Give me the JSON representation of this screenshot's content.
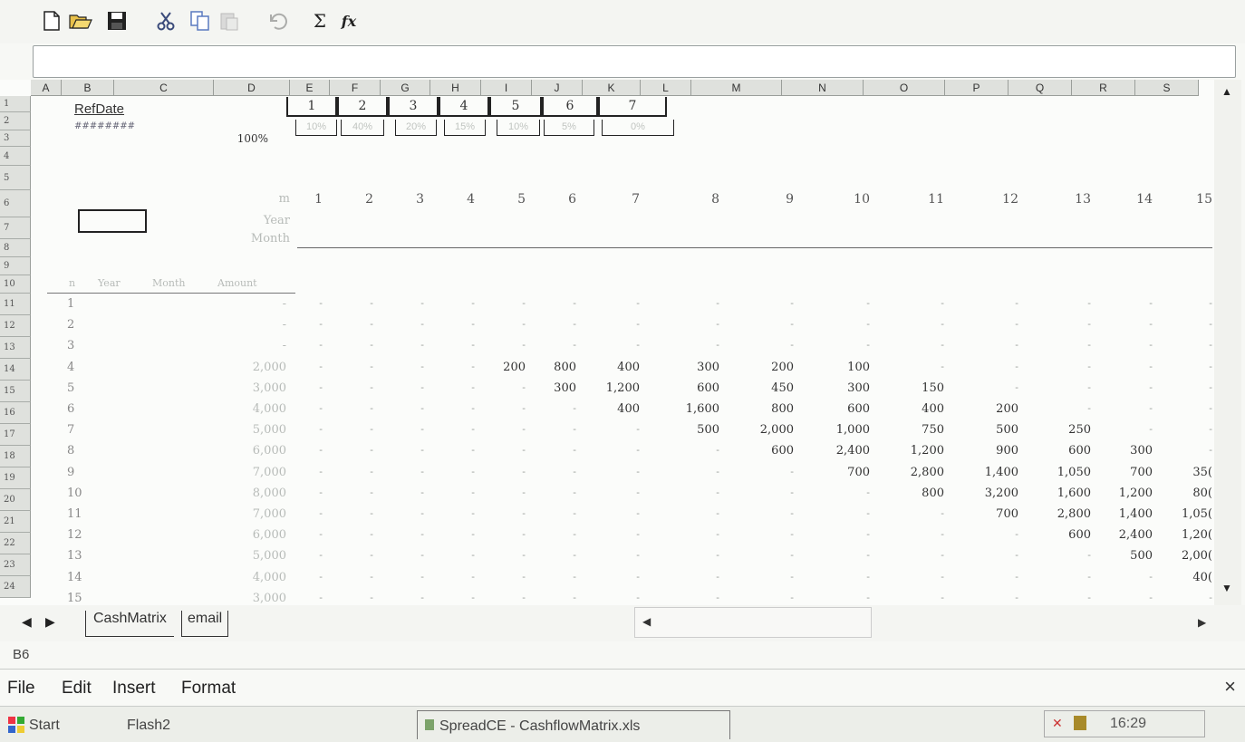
{
  "toolbar": {
    "icons": [
      "new-icon",
      "open-icon",
      "save-icon",
      "cut-icon",
      "copy-icon",
      "paste-icon",
      "undo-icon",
      "autosum-icon",
      "function-icon"
    ],
    "sum_glyph": "Σ",
    "fx_glyph": "fx"
  },
  "formula_bar": {
    "value": ""
  },
  "columns": [
    "A",
    "B",
    "C",
    "D",
    "E",
    "F",
    "G",
    "H",
    "I",
    "J",
    "K",
    "L",
    "M",
    "N",
    "O",
    "P",
    "Q",
    "R",
    "S"
  ],
  "rows": [
    "1",
    "2",
    "3",
    "4",
    "5",
    "6",
    "7",
    "8",
    "9",
    "10",
    "11",
    "12",
    "13",
    "14",
    "15",
    "16",
    "17",
    "18",
    "19",
    "20",
    "21",
    "22",
    "23",
    "24"
  ],
  "sheet": {
    "refdate_label": "RefDate",
    "refdate_value": "########",
    "pct_total": "100%",
    "period_boxes": [
      "1",
      "2",
      "3",
      "4",
      "5",
      "6",
      "7"
    ],
    "pct_boxes": [
      "10%",
      "40%",
      "20%",
      "15%",
      "10%",
      "5%",
      "0%"
    ],
    "row5_label": "m",
    "row6_label": "Year",
    "row7_label": "Month",
    "timeline": [
      "1",
      "2",
      "3",
      "4",
      "5",
      "6",
      "7",
      "8",
      "9",
      "10",
      "11",
      "12",
      "13",
      "14",
      "15"
    ],
    "table_headers": [
      "n",
      "Year",
      "Month",
      "Amount"
    ],
    "data_rows": [
      {
        "n": "1",
        "amount": "-",
        "cells": [
          "-",
          "-",
          "-",
          "-",
          "-",
          "-",
          "-",
          "-",
          "-",
          "-",
          "-",
          "-",
          "-",
          "-",
          "-"
        ]
      },
      {
        "n": "2",
        "amount": "-",
        "cells": [
          "-",
          "-",
          "-",
          "-",
          "-",
          "-",
          "-",
          "-",
          "-",
          "-",
          "-",
          "-",
          "-",
          "-",
          "-"
        ]
      },
      {
        "n": "3",
        "amount": "-",
        "cells": [
          "-",
          "-",
          "-",
          "-",
          "-",
          "-",
          "-",
          "-",
          "-",
          "-",
          "-",
          "-",
          "-",
          "-",
          "-"
        ]
      },
      {
        "n": "4",
        "amount": "2,000",
        "cells": [
          "-",
          "-",
          "-",
          "-",
          "200",
          "800",
          "400",
          "300",
          "200",
          "100",
          "-",
          "-",
          "-",
          "-",
          "-"
        ]
      },
      {
        "n": "5",
        "amount": "3,000",
        "cells": [
          "-",
          "-",
          "-",
          "-",
          "-",
          "300",
          "1,200",
          "600",
          "450",
          "300",
          "150",
          "-",
          "-",
          "-",
          "-"
        ]
      },
      {
        "n": "6",
        "amount": "4,000",
        "cells": [
          "-",
          "-",
          "-",
          "-",
          "-",
          "-",
          "400",
          "1,600",
          "800",
          "600",
          "400",
          "200",
          "-",
          "-",
          "-"
        ]
      },
      {
        "n": "7",
        "amount": "5,000",
        "cells": [
          "-",
          "-",
          "-",
          "-",
          "-",
          "-",
          "-",
          "500",
          "2,000",
          "1,000",
          "750",
          "500",
          "250",
          "-",
          "-"
        ]
      },
      {
        "n": "8",
        "amount": "6,000",
        "cells": [
          "-",
          "-",
          "-",
          "-",
          "-",
          "-",
          "-",
          "-",
          "600",
          "2,400",
          "1,200",
          "900",
          "600",
          "300",
          "-"
        ]
      },
      {
        "n": "9",
        "amount": "7,000",
        "cells": [
          "-",
          "-",
          "-",
          "-",
          "-",
          "-",
          "-",
          "-",
          "-",
          "700",
          "2,800",
          "1,400",
          "1,050",
          "700",
          "35("
        ]
      },
      {
        "n": "10",
        "amount": "8,000",
        "cells": [
          "-",
          "-",
          "-",
          "-",
          "-",
          "-",
          "-",
          "-",
          "-",
          "-",
          "800",
          "3,200",
          "1,600",
          "1,200",
          "80("
        ]
      },
      {
        "n": "11",
        "amount": "7,000",
        "cells": [
          "-",
          "-",
          "-",
          "-",
          "-",
          "-",
          "-",
          "-",
          "-",
          "-",
          "-",
          "700",
          "2,800",
          "1,400",
          "1,05("
        ]
      },
      {
        "n": "12",
        "amount": "6,000",
        "cells": [
          "-",
          "-",
          "-",
          "-",
          "-",
          "-",
          "-",
          "-",
          "-",
          "-",
          "-",
          "-",
          "600",
          "2,400",
          "1,20("
        ]
      },
      {
        "n": "13",
        "amount": "5,000",
        "cells": [
          "-",
          "-",
          "-",
          "-",
          "-",
          "-",
          "-",
          "-",
          "-",
          "-",
          "-",
          "-",
          "-",
          "500",
          "2,00("
        ]
      },
      {
        "n": "14",
        "amount": "4,000",
        "cells": [
          "-",
          "-",
          "-",
          "-",
          "-",
          "-",
          "-",
          "-",
          "-",
          "-",
          "-",
          "-",
          "-",
          "-",
          "40("
        ]
      },
      {
        "n": "15",
        "amount": "3,000",
        "cells": [
          "-",
          "-",
          "-",
          "-",
          "-",
          "-",
          "-",
          "-",
          "-",
          "-",
          "-",
          "-",
          "-",
          "-",
          "-"
        ]
      }
    ]
  },
  "tabs": [
    "CashMatrix",
    "email"
  ],
  "cell_reference": "B6",
  "menu": [
    "File",
    "Edit",
    "Insert",
    "Format"
  ],
  "close_glyph": "×",
  "taskbar": {
    "start": "Start",
    "flash": "Flash2",
    "window": "SpreadCE - CashflowMatrix.xls",
    "time": "16:29"
  }
}
